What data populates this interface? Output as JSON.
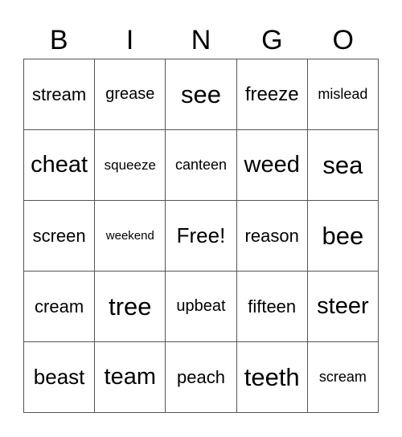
{
  "header": [
    "B",
    "I",
    "N",
    "G",
    "O"
  ],
  "rows": [
    [
      "stream",
      "grease",
      "see",
      "freeze",
      "mislead"
    ],
    [
      "cheat",
      "squeeze",
      "canteen",
      "weed",
      "sea"
    ],
    [
      "screen",
      "weekend",
      "Free!",
      "reason",
      "bee"
    ],
    [
      "cream",
      "tree",
      "upbeat",
      "fifteen",
      "steer"
    ],
    [
      "beast",
      "team",
      "peach",
      "teeth",
      "scream"
    ]
  ]
}
